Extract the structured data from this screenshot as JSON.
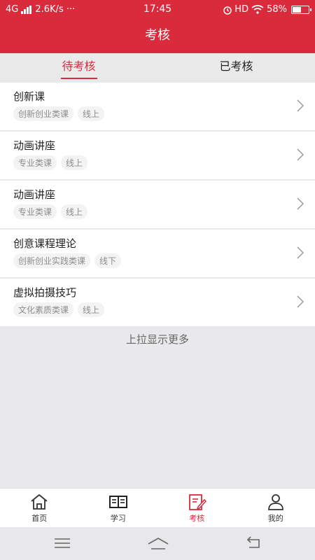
{
  "status": {
    "network": "4G",
    "speed": "2.6K/s",
    "dots": "···",
    "time": "17:45",
    "hd": "HD",
    "battery": "58%",
    "battery_level": 0.58
  },
  "header": {
    "title": "考核"
  },
  "tabs": [
    {
      "label": "待考核",
      "active": true
    },
    {
      "label": "已考核",
      "active": false
    }
  ],
  "items": [
    {
      "title": "创新课",
      "tags": [
        "创新创业类课",
        "线上"
      ]
    },
    {
      "title": "动画讲座",
      "tags": [
        "专业类课",
        "线上"
      ]
    },
    {
      "title": "动画讲座",
      "tags": [
        "专业类课",
        "线上"
      ]
    },
    {
      "title": "创意课程理论",
      "tags": [
        "创新创业实践类课",
        "线下"
      ]
    },
    {
      "title": "虚拟拍摄技巧",
      "tags": [
        "文化素质类课",
        "线上"
      ]
    }
  ],
  "more_text": "上拉显示更多",
  "nav": [
    {
      "label": "首页",
      "icon": "home-icon"
    },
    {
      "label": "学习",
      "icon": "book-icon"
    },
    {
      "label": "考核",
      "icon": "exam-icon",
      "active": true
    },
    {
      "label": "我的",
      "icon": "profile-icon"
    }
  ],
  "colors": {
    "accent": "#d92b3c",
    "background": "#e9e9eb"
  }
}
